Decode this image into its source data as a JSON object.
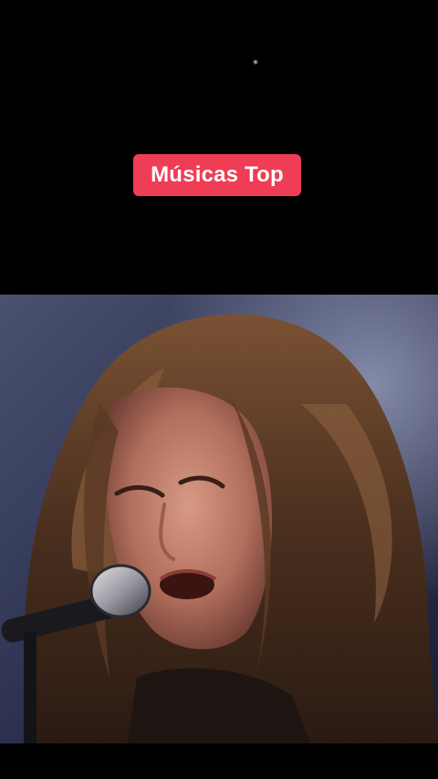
{
  "overlay": {
    "title": "Músicas Top",
    "title_bg_color": "#ee3d55",
    "title_text_color": "#ffffff"
  },
  "video": {
    "content": "video-frame-singer-at-microphone",
    "background_color": "#000000"
  },
  "icons": {
    "microphone": "microphone-icon"
  }
}
